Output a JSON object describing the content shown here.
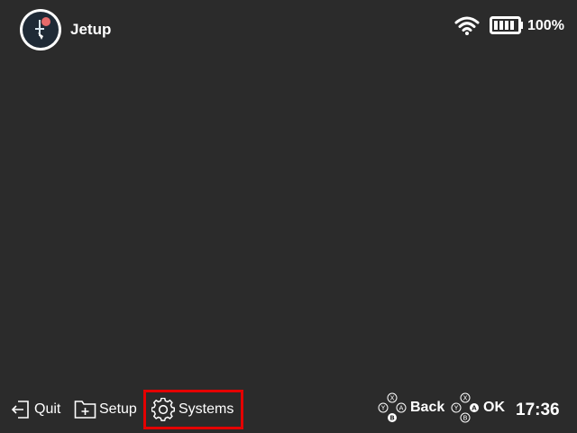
{
  "header": {
    "app_title": "Jetup",
    "battery_percent": "100%",
    "wifi_icon": "wifi-icon",
    "battery_icon": "battery-full-icon",
    "logo_icon": "app-logo-icon"
  },
  "footer": {
    "quit_label": "Quit",
    "setup_label": "Setup",
    "systems_label": "Systems",
    "back_label": "Back",
    "ok_label": "OK",
    "clock": "17:36",
    "selected_item": "Systems",
    "selection_color": "#e40000"
  },
  "colors": {
    "background": "#2b2b2b",
    "text": "#ffffff",
    "highlight": "#e40000"
  },
  "button_glyphs": {
    "top": "X",
    "left": "Y",
    "right": "A",
    "bottom": "B"
  }
}
